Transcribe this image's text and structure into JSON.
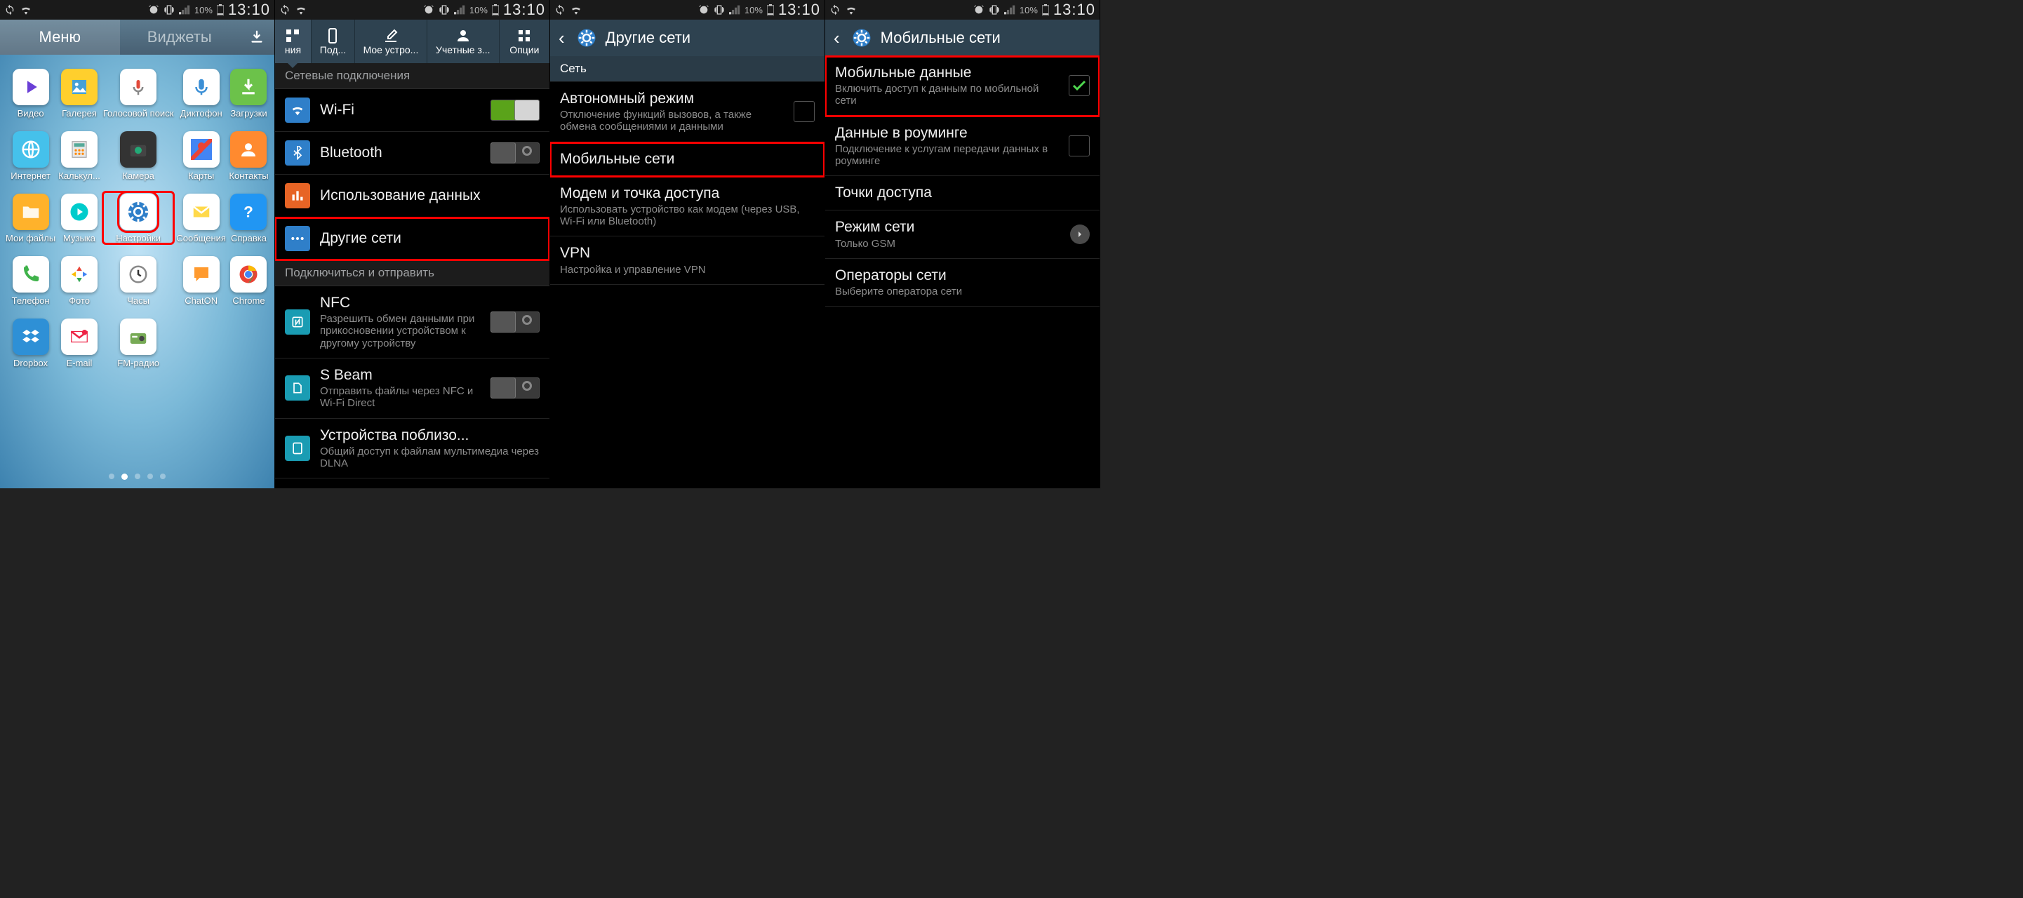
{
  "status": {
    "battery_pct": "10%",
    "clock": "13:10"
  },
  "screen1": {
    "tab_menu": "Меню",
    "tab_widgets": "Виджеты",
    "apps": [
      {
        "label": "Видео",
        "bg": "#fff"
      },
      {
        "label": "Галерея",
        "bg": "#ffcf2d"
      },
      {
        "label": "Голосовой поиск",
        "bg": "#fff"
      },
      {
        "label": "Диктофон",
        "bg": "#fff"
      },
      {
        "label": "Загрузки",
        "bg": "#6cc24a"
      },
      {
        "label": "Интернет",
        "bg": "#45c1eb"
      },
      {
        "label": "Калькул...",
        "bg": "#fff"
      },
      {
        "label": "Камера",
        "bg": "#333"
      },
      {
        "label": "Карты",
        "bg": "#fff"
      },
      {
        "label": "Контакты",
        "bg": "#ff8a2f"
      },
      {
        "label": "Мои файлы",
        "bg": "#ffb22b"
      },
      {
        "label": "Музыка",
        "bg": "#fff"
      },
      {
        "label": "Настройки",
        "bg": "#fff",
        "highlight": true
      },
      {
        "label": "Сообщения",
        "bg": "#fff"
      },
      {
        "label": "Справка",
        "bg": "#2196f3"
      },
      {
        "label": "Телефон",
        "bg": "#fff"
      },
      {
        "label": "Фото",
        "bg": "#fff"
      },
      {
        "label": "Часы",
        "bg": "#fff"
      },
      {
        "label": "ChatON",
        "bg": "#fff"
      },
      {
        "label": "Chrome",
        "bg": "#fff"
      },
      {
        "label": "Dropbox",
        "bg": "#2e90d6"
      },
      {
        "label": "E-mail",
        "bg": "#fff"
      },
      {
        "label": "FM-радио",
        "bg": "#fff"
      }
    ]
  },
  "screen2": {
    "tabs": [
      "ния",
      "Под...",
      "Мое устро...",
      "Учетные з...",
      "Опции"
    ],
    "section_network": "Сетевые подключения",
    "wifi": "Wi-Fi",
    "bluetooth": "Bluetooth",
    "data_usage": "Использование данных",
    "more_networks": "Другие сети",
    "section_share": "Подключиться и отправить",
    "nfc_title": "NFC",
    "nfc_sub": "Разрешить обмен данными при прикосновении устройством к другому устройству",
    "sbeam_title": "S Beam",
    "sbeam_sub": "Отправить файлы через NFC и Wi-Fi Direct",
    "nearby_title": "Устройства поблизо...",
    "nearby_sub": "Общий доступ к файлам мультимедиа через DLNA"
  },
  "screen3": {
    "title": "Другие сети",
    "section": "Сеть",
    "airplane_title": "Автономный режим",
    "airplane_sub": "Отключение функций вызовов, а также обмена сообщениями и данными",
    "mobile_networks": "Мобильные сети",
    "tether_title": "Модем и точка доступа",
    "tether_sub": "Использовать устройство как модем (через USB, Wi-Fi или Bluetooth)",
    "vpn_title": "VPN",
    "vpn_sub": "Настройка и управление VPN"
  },
  "screen4": {
    "title": "Мобильные сети",
    "mobile_data_title": "Мобильные данные",
    "mobile_data_sub": "Включить доступ к данным по мобильной сети",
    "roaming_title": "Данные в роуминге",
    "roaming_sub": "Подключение к услугам передачи данных в роуминге",
    "apn": "Точки доступа",
    "mode_title": "Режим сети",
    "mode_sub": "Только GSM",
    "operators_title": "Операторы сети",
    "operators_sub": "Выберите оператора сети"
  }
}
